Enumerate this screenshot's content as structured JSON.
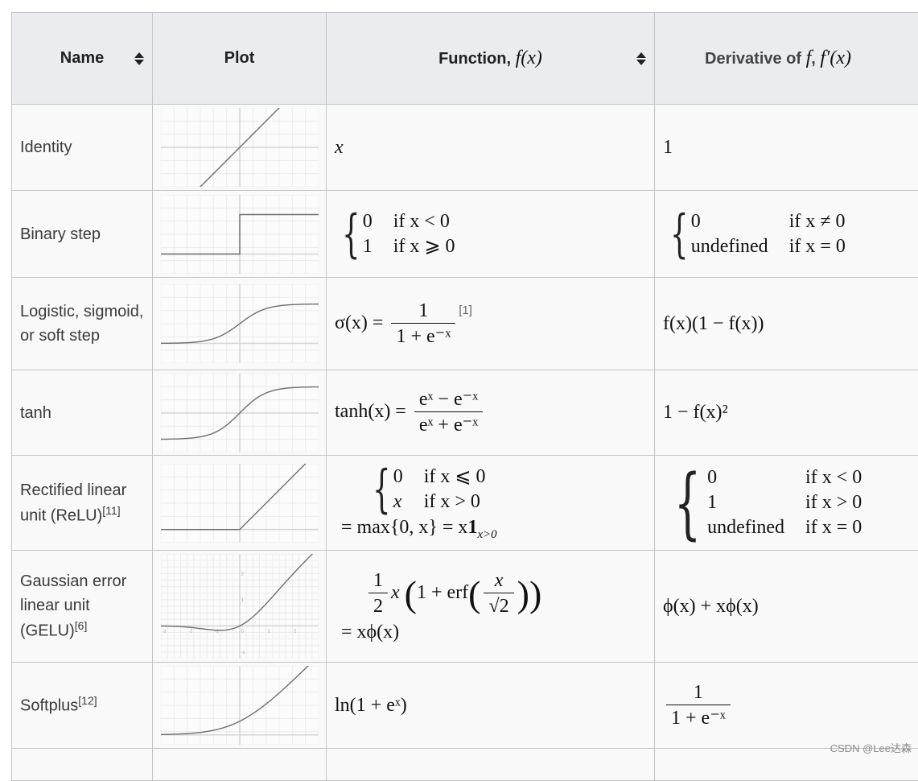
{
  "table": {
    "headers": {
      "name": "Name",
      "plot": "Plot",
      "function_text": "Function, ",
      "function_math": "f(x)",
      "derivative_text": "Derivative of ",
      "derivative_math_f": "f",
      "derivative_sep": ", ",
      "derivative_math": "f′(x)"
    },
    "sortable_columns": [
      "Name",
      "Function, f(x)"
    ],
    "rows": [
      {
        "name": "Identity",
        "name_ref": "",
        "function": "x",
        "derivative": "1"
      },
      {
        "name": "Binary step",
        "name_ref": "",
        "function_cases": [
          [
            "0",
            "if x < 0"
          ],
          [
            "1",
            "if x ⩾ 0"
          ]
        ],
        "derivative_cases": [
          [
            "0",
            "if x ≠ 0"
          ],
          [
            "undefined",
            "if x = 0"
          ]
        ]
      },
      {
        "name": "Logistic, sigmoid, or soft step",
        "name_ref": "",
        "function_lhs": "σ(x) =",
        "function_num": "1",
        "function_den": "1 + e⁻ˣ",
        "function_ref": "[1]",
        "derivative": "f(x)(1 − f(x))"
      },
      {
        "name": "tanh",
        "name_ref": "",
        "function_lhs": "tanh(x) =",
        "function_num": "eˣ − e⁻ˣ",
        "function_den": "eˣ + e⁻ˣ",
        "derivative": "1 − f(x)²"
      },
      {
        "name": "Rectified linear unit (ReLU)",
        "name_ref": "[11]",
        "function_cases": [
          [
            "0",
            "if x ⩽ 0"
          ],
          [
            "x",
            "if x > 0"
          ]
        ],
        "function_line2": "=  max{0, x} = x",
        "function_line2_bold": "1",
        "function_line2_sub": "x>0",
        "derivative_cases": [
          [
            "0",
            "if x < 0"
          ],
          [
            "1",
            "if x > 0"
          ],
          [
            "undefined",
            "if x = 0"
          ]
        ]
      },
      {
        "name": "Gaussian error linear unit (GELU)",
        "name_ref": "[6]",
        "function_half_num": "1",
        "function_half_den": "2",
        "function_mid": "x",
        "function_inner": "1 + erf",
        "function_inner_num": "x",
        "function_inner_den": "√2",
        "function_line2": "= xϕ(x)",
        "derivative": "ϕ(x) + xϕ(x)"
      },
      {
        "name": "Softplus",
        "name_ref": "[12]",
        "function": "ln(1 + eˣ)",
        "derivative_num": "1",
        "derivative_den": "1 + e⁻ˣ"
      }
    ]
  },
  "chart_data": [
    {
      "type": "line",
      "title": "Identity",
      "function": "identity",
      "xlim": [
        -3,
        3
      ],
      "ylim": [
        -1.5,
        1.5
      ],
      "grid": true,
      "grid_cells": [
        12,
        6
      ],
      "x_axis_y": 0
    },
    {
      "type": "line",
      "title": "Binary step",
      "function": "step",
      "xlim": [
        -3,
        3
      ],
      "ylim": [
        -0.5,
        1.5
      ],
      "grid": true,
      "grid_cells": [
        12,
        6
      ],
      "x_axis_y": 0
    },
    {
      "type": "line",
      "title": "Logistic",
      "function": "sigmoid",
      "xlim": [
        -6,
        6
      ],
      "ylim": [
        -0.5,
        1.5
      ],
      "grid": true,
      "grid_cells": [
        12,
        6
      ],
      "x_axis_y": 0
    },
    {
      "type": "line",
      "title": "tanh",
      "function": "tanh",
      "xlim": [
        -3,
        3
      ],
      "ylim": [
        -1.5,
        1.5
      ],
      "grid": true,
      "grid_cells": [
        12,
        6
      ],
      "x_axis_y": 0
    },
    {
      "type": "line",
      "title": "ReLU",
      "function": "relu",
      "xlim": [
        -3,
        3
      ],
      "ylim": [
        -0.5,
        2.5
      ],
      "grid": true,
      "grid_cells": [
        12,
        6
      ],
      "x_axis_y": 0
    },
    {
      "type": "line",
      "title": "GELU",
      "function": "gelu",
      "xlim": [
        -3,
        3
      ],
      "ylim": [
        -1.25,
        2.75
      ],
      "grid": true,
      "grid_cells": [
        24,
        16
      ],
      "x_axis_y": 0,
      "x_ticks": [
        "-3",
        "-2",
        "-1",
        "0",
        "1",
        "2",
        "3"
      ],
      "y_ticks": [
        "-1",
        "1",
        "2"
      ]
    },
    {
      "type": "line",
      "title": "Softplus",
      "function": "softplus",
      "xlim": [
        -4,
        4
      ],
      "ylim": [
        -0.5,
        3.5
      ],
      "grid": true,
      "grid_cells": [
        12,
        6
      ],
      "x_axis_y": 0
    }
  ],
  "watermark": "CSDN @Lee达森"
}
